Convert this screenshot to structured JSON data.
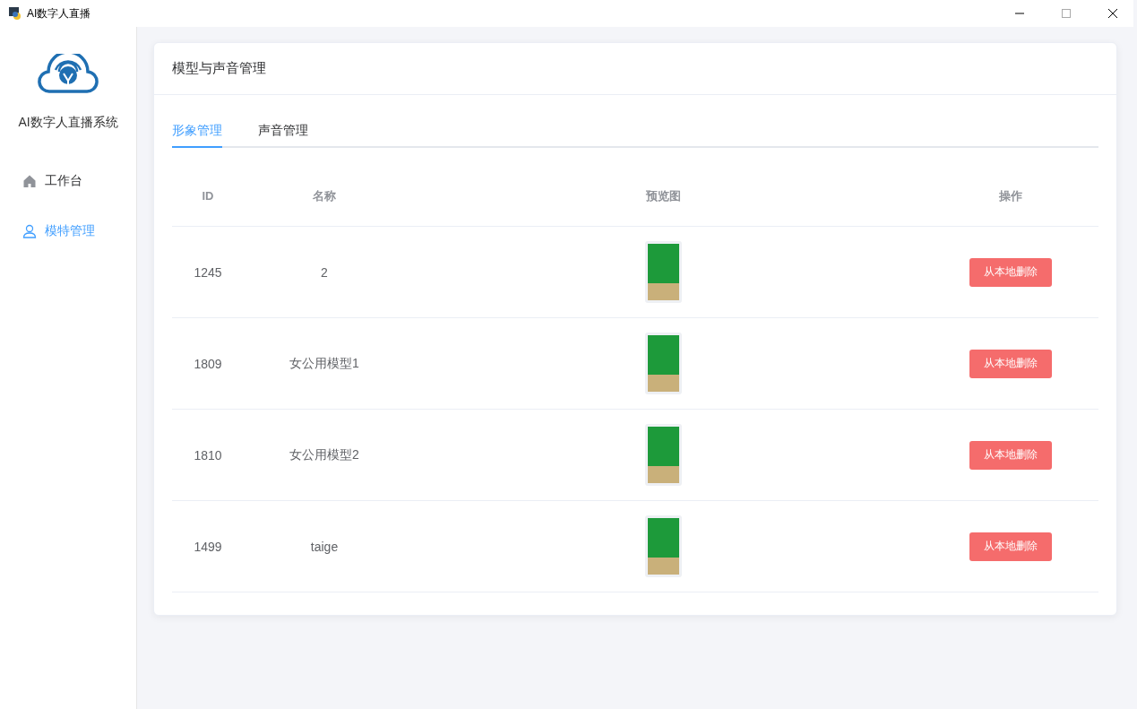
{
  "window": {
    "title": "AI数字人直播"
  },
  "sidebar": {
    "app_name": "AI数字人直播系统",
    "items": [
      {
        "label": "工作台",
        "kind": "home",
        "selected": false
      },
      {
        "label": "模特管理",
        "kind": "user",
        "selected": true
      }
    ]
  },
  "card": {
    "title": "模型与声音管理"
  },
  "tabs": [
    {
      "label": "形象管理",
      "selected": true
    },
    {
      "label": "声音管理",
      "selected": false
    }
  ],
  "table": {
    "columns": [
      "ID",
      "名称",
      "预览图",
      "操作"
    ],
    "rows": [
      {
        "id": "1245",
        "name": "2",
        "action": "从本地删除"
      },
      {
        "id": "1809",
        "name": "女公用模型1",
        "action": "从本地删除"
      },
      {
        "id": "1810",
        "name": "女公用模型2",
        "action": "从本地删除"
      },
      {
        "id": "1499",
        "name": "taige",
        "action": "从本地删除"
      }
    ]
  }
}
